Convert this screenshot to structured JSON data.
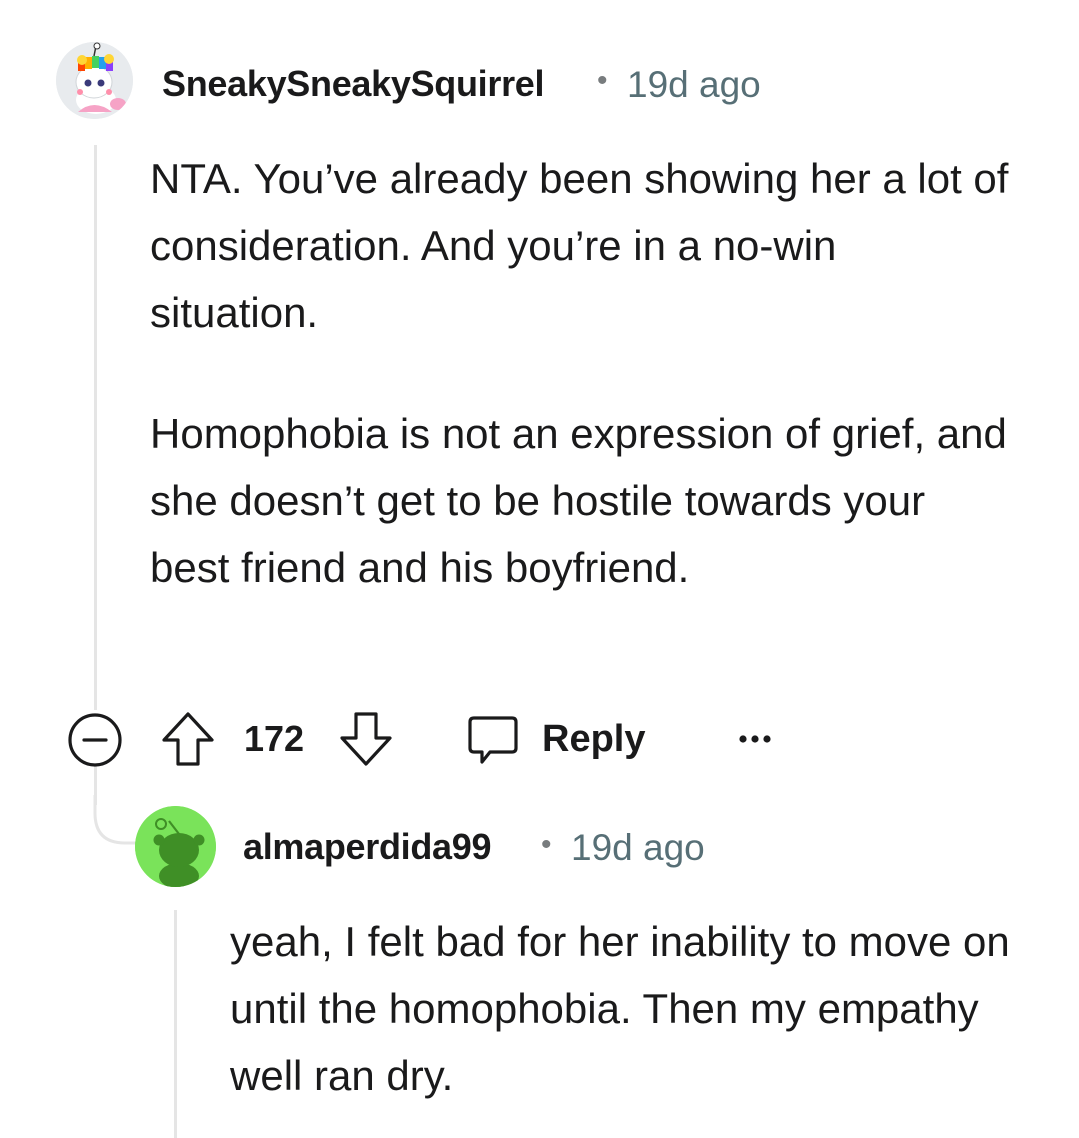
{
  "comments": [
    {
      "username": "SneakySneakySquirrel",
      "separator": "•",
      "timestamp": "19d ago",
      "paragraphs": [
        "NTA. You’ve already been showing her a lot of consideration. And you’re in a no-win situation.",
        "Homophobia is not an expression of grief, and she doesn’t get to be hostile towards your best friend and his boyfriend."
      ],
      "actions": {
        "upvotes": "172",
        "reply_label": "Reply"
      }
    },
    {
      "username": "almaperdida99",
      "separator": "•",
      "timestamp": "19d ago",
      "paragraphs": [
        "yeah, I felt bad for her inability to move on until the homophobia. Then my empathy well ran dry."
      ]
    }
  ],
  "icons": {
    "collapse": "collapse-icon",
    "upvote": "upvote-arrow-icon",
    "downvote": "downvote-arrow-icon",
    "reply": "reply-bubble-icon",
    "more": "more-options-icon"
  },
  "colors": {
    "text": "#1a1a1b",
    "meta": "#576f76",
    "thread_line": "#e5e5e5",
    "second_avatar_bg": "#7ae35a"
  }
}
